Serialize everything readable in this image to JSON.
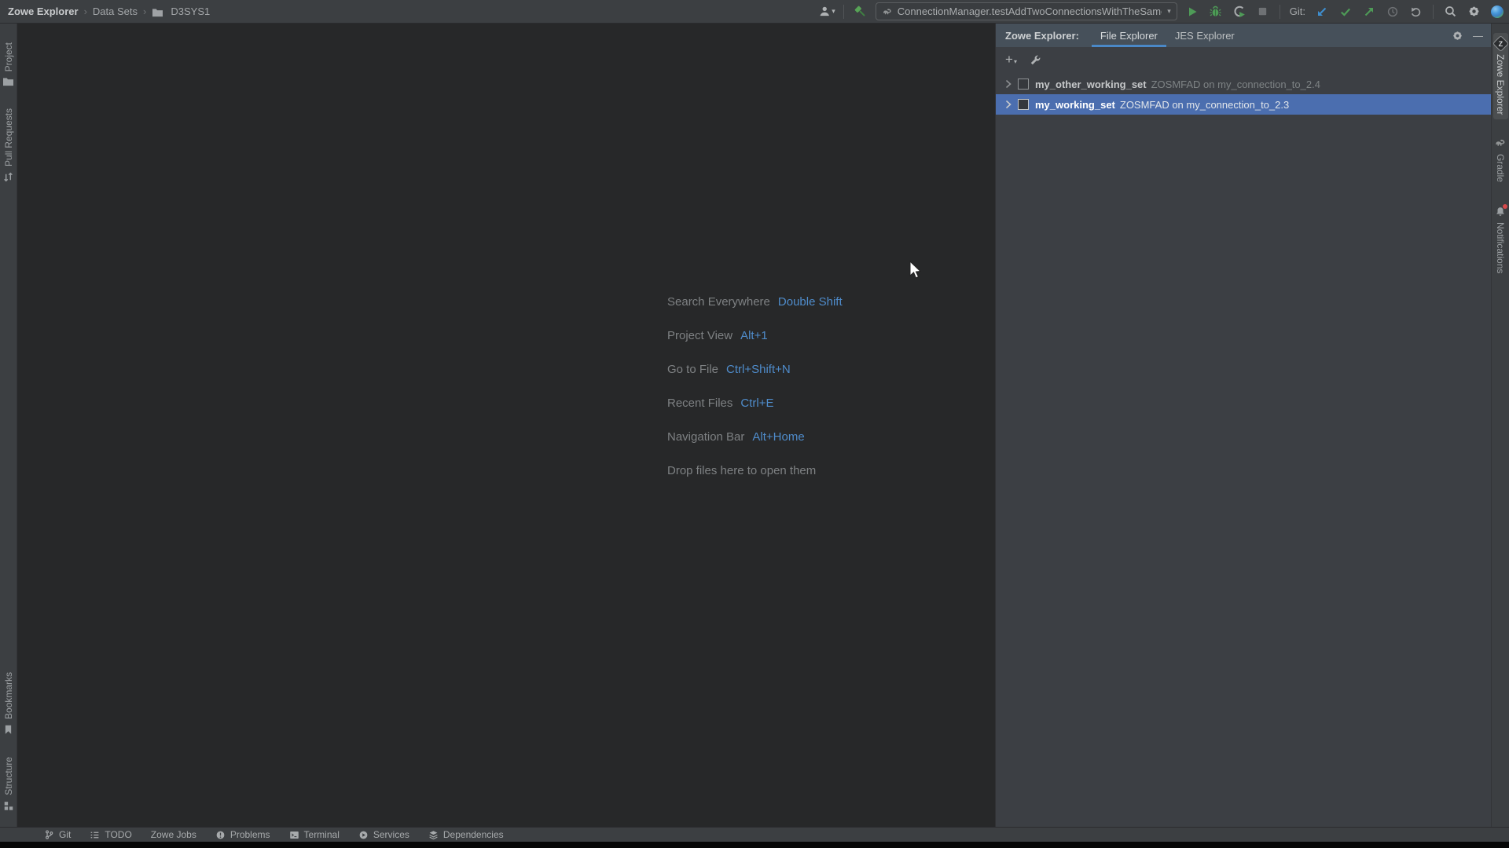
{
  "topbar": {
    "breadcrumb": [
      "Zowe Explorer",
      "Data Sets",
      "D3SYS1"
    ],
    "run_config": "ConnectionManager.testAddTwoConnectionsWithTheSameName",
    "git_label": "Git:"
  },
  "left_stripe": {
    "top": [
      {
        "label": "Project"
      },
      {
        "label": "Pull Requests"
      }
    ],
    "bottom": [
      {
        "label": "Bookmarks"
      },
      {
        "label": "Structure"
      }
    ]
  },
  "right_stripe": {
    "items": [
      {
        "label": "Zowe Explorer",
        "active": true
      },
      {
        "label": "Gradle",
        "active": false
      },
      {
        "label": "Notifications",
        "active": false
      }
    ]
  },
  "editor": {
    "shortcuts": [
      {
        "label": "Search Everywhere",
        "keys": "Double Shift"
      },
      {
        "label": "Project View",
        "keys": "Alt+1"
      },
      {
        "label": "Go to File",
        "keys": "Ctrl+Shift+N"
      },
      {
        "label": "Recent Files",
        "keys": "Ctrl+E"
      },
      {
        "label": "Navigation Bar",
        "keys": "Alt+Home"
      }
    ],
    "drop_hint": "Drop files here to open them"
  },
  "panel": {
    "title": "Zowe Explorer:",
    "tabs": [
      {
        "label": "File Explorer",
        "active": true
      },
      {
        "label": "JES Explorer",
        "active": false
      }
    ],
    "tree": [
      {
        "name": "my_other_working_set",
        "detail": "ZOSMFAD on my_connection_to_2.4",
        "selected": false
      },
      {
        "name": "my_working_set",
        "detail": "ZOSMFAD on my_connection_to_2.3",
        "selected": true
      }
    ]
  },
  "statusbar": {
    "items": [
      {
        "label": "Git"
      },
      {
        "label": "TODO"
      },
      {
        "label": "Zowe Jobs"
      },
      {
        "label": "Problems"
      },
      {
        "label": "Terminal"
      },
      {
        "label": "Services"
      },
      {
        "label": "Dependencies"
      }
    ]
  },
  "icons": {
    "breadcrumb_sep": "›",
    "caret_down": "▾",
    "plus": "+",
    "minimize": "—",
    "zowe_letter": "Z"
  },
  "colors": {
    "selection_blue": "#4B6EAF",
    "tab_underline_blue": "#4A88C7",
    "shortcut_blue": "#4F8CCB",
    "run_green": "#4E9B57",
    "git_update_blue": "#3E8FD0",
    "panel_header": "#46505A",
    "panel_bg": "#3C3F44",
    "editor_bg": "#272829",
    "bar_bg": "#3C3F42",
    "working_set_teal": "#3FAFC0"
  }
}
